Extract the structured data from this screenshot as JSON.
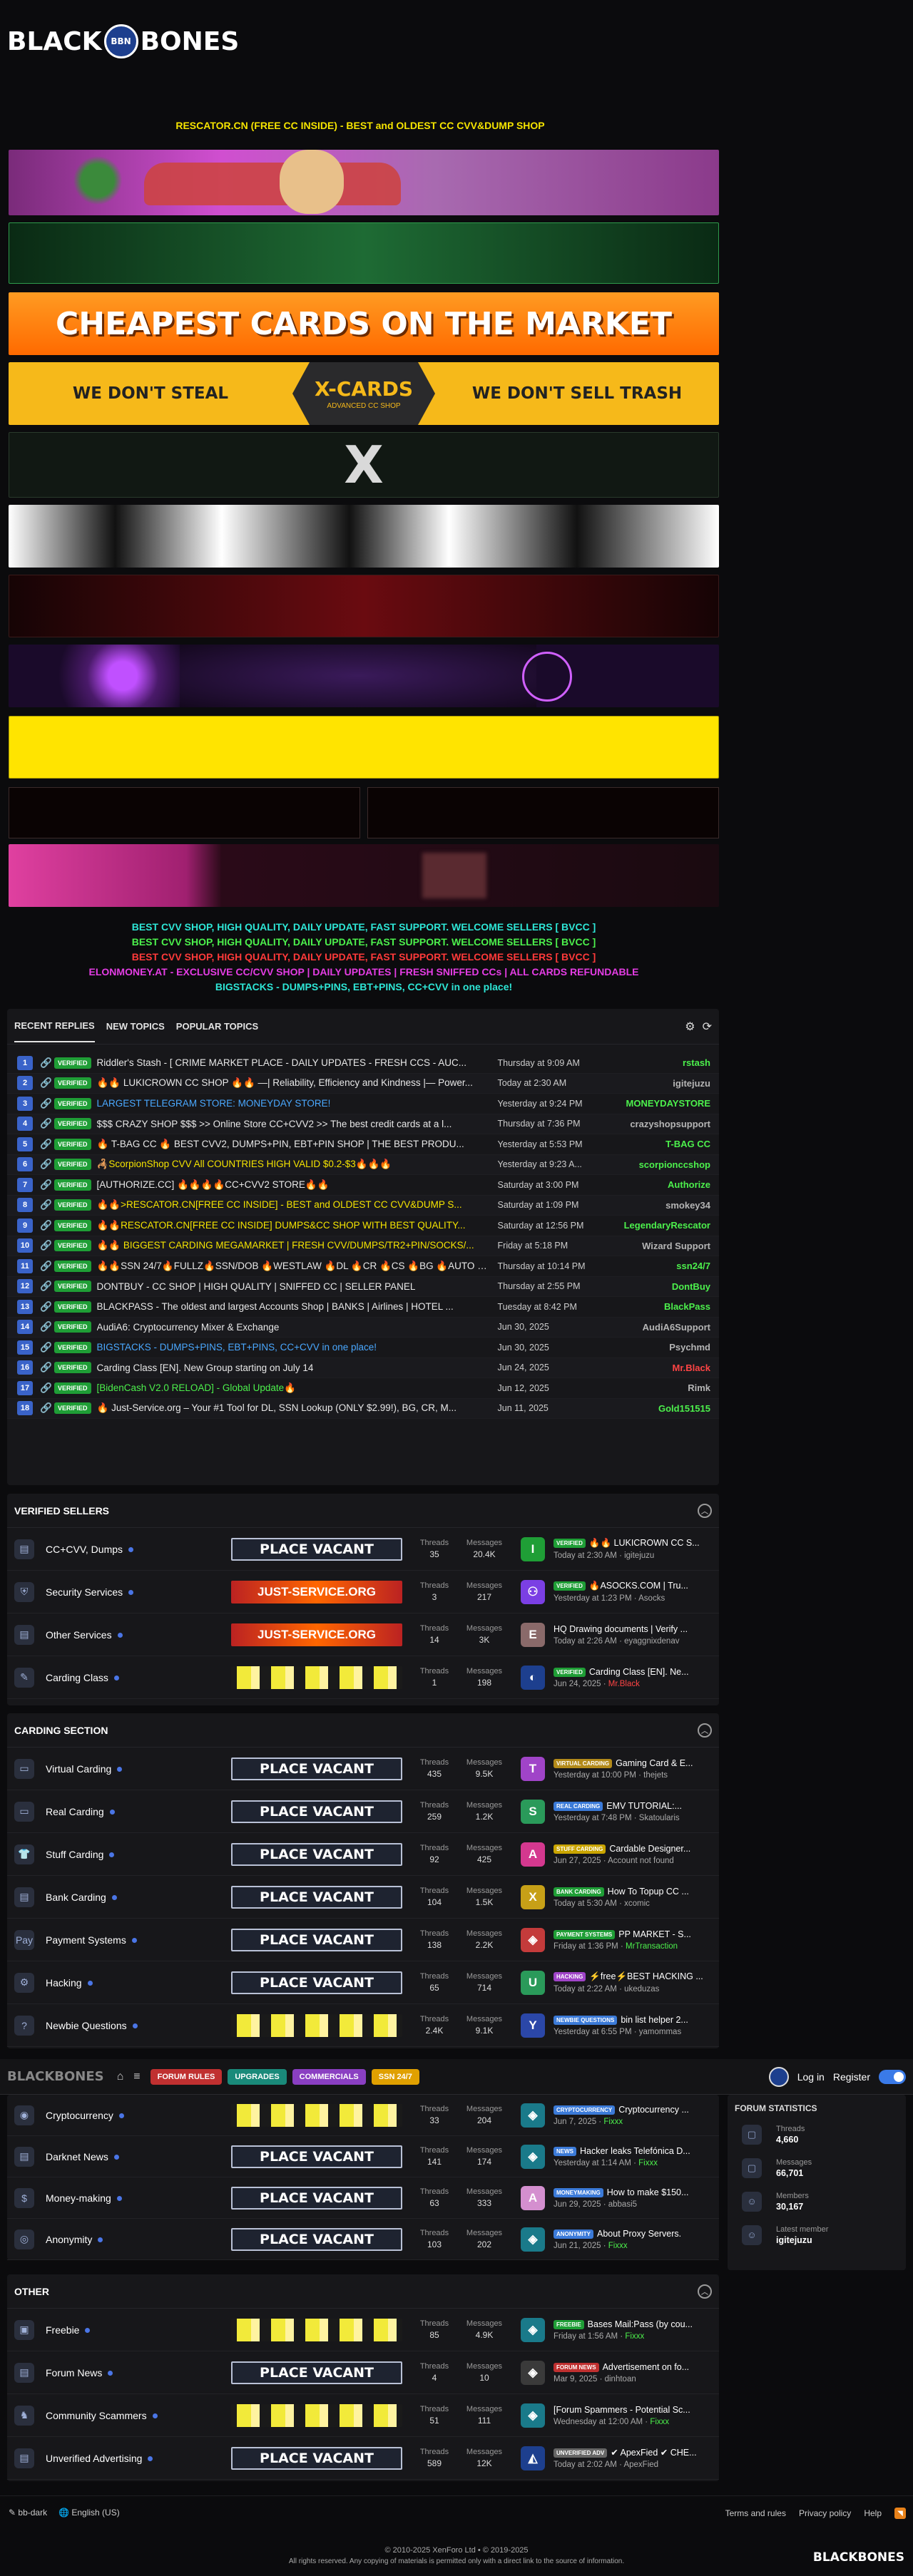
{
  "header": {
    "logo_left": "BLACK",
    "logo_right": "BONES",
    "logo_emblem": "BBN",
    "title": "RESCATOR.CN (FREE CC INSIDE) - BEST and OLDEST CC CVV&DUMP SHOP"
  },
  "banners": {
    "cheapest": "CHEAPEST CARDS ON THE MARKET",
    "xcards_left": "WE DON'T STEAL",
    "xcards_right": "WE DON'T SELL TRASH",
    "xcards_name": "X-CARDS",
    "xcards_sub": "ADVANCED CC SHOP",
    "x_letter": "X"
  },
  "ads": [
    {
      "text": "BEST CVV SHOP, HIGH QUALITY, DAILY UPDATE, FAST SUPPORT. WELCOME SELLERS [ BVCC ]",
      "color": "#2ee6d6"
    },
    {
      "text": "BEST CVV SHOP, HIGH QUALITY, DAILY UPDATE, FAST SUPPORT. WELCOME SELLERS [ BVCC ]",
      "color": "#4cf04c"
    },
    {
      "text": "BEST CVV SHOP, HIGH QUALITY, DAILY UPDATE, FAST SUPPORT. WELCOME SELLERS [ BVCC ]",
      "color": "#ff3a3a"
    },
    {
      "text": "ELONMONEY.AT - EXCLUSIVE CC/CVV SHOP | DAILY UPDATES | FRESH SNIFFED CCs | ALL CARDS REFUNDABLE",
      "color": "#e43de4"
    },
    {
      "text": "BIGSTACKS - DUMPS+PINS, EBT+PINS, CC+CVV in one place!",
      "color": "#2ee6d6"
    }
  ],
  "tabs": [
    "Recent replies",
    "New topics",
    "Popular topics"
  ],
  "badge_verified": "VERIFIED",
  "recent": [
    {
      "n": "1",
      "title": "Riddler's Stash - [ CRIME MARKET PLACE - DAILY UPDATES - FRESH CCS - AUC...",
      "date": "Thursday at 9:09 AM",
      "user": "rstash",
      "tcolor": "#e8e8e8",
      "ucolor": "#4cf04c"
    },
    {
      "n": "2",
      "title": "🔥🔥 LUKICROWN CC SHOP 🔥🔥 —| Reliability, Efficiency and Kindness |— Power...",
      "date": "Today at 2:30 AM",
      "user": "igitejuzu",
      "tcolor": "#e8e8e8",
      "ucolor": "#b5b5b5"
    },
    {
      "n": "3",
      "title": "LARGEST TELEGRAM STORE: MONEYDAY STORE!",
      "date": "Yesterday at 9:24 PM",
      "user": "MONEYDAYSTORE",
      "tcolor": "#4aa8ff",
      "ucolor": "#4cf04c"
    },
    {
      "n": "4",
      "title": "$$$ CRAZY SHOP $$$ >> Online Store CC+CVV2 >> The best credit cards at a l...",
      "date": "Thursday at 7:36 PM",
      "user": "crazyshopsupport",
      "tcolor": "#e8e8e8",
      "ucolor": "#b5b5b5"
    },
    {
      "n": "5",
      "title": "🔥 T-BAG CC 🔥 BEST CVV2, DUMPS+PIN, EBT+PIN SHOP | THE BEST PRODU...",
      "date": "Yesterday at 5:53 PM",
      "user": "T-BAG CC",
      "tcolor": "#e8e8e8",
      "ucolor": "#4cf04c"
    },
    {
      "n": "6",
      "title": "🦂ScorpionShop CVV All COUNTRIES HIGH VALID $0.2-$3🔥🔥🔥",
      "date": "Yesterday at 9:23 A...",
      "user": "scorpionccshop",
      "tcolor": "#f5e400",
      "ucolor": "#4cf04c"
    },
    {
      "n": "7",
      "title": "[AUTHORIZE.CC] 🔥🔥🔥🔥CC+CVV2 STORE🔥🔥",
      "date": "Saturday at 3:00 PM",
      "user": "Authorize",
      "tcolor": "#e8e8e8",
      "ucolor": "#4cf04c"
    },
    {
      "n": "8",
      "title": "🔥🔥>RESCATOR.CN[FREE CC INSIDE] - BEST and OLDEST CC CVV&DUMP S...",
      "date": "Saturday at 1:09 PM",
      "user": "smokey34",
      "tcolor": "#f5e400",
      "ucolor": "#b5b5b5"
    },
    {
      "n": "9",
      "title": "🔥🔥RESCATOR.CN[FREE CC INSIDE] DUMPS&CC SHOP WITH BEST QUALITY...",
      "date": "Saturday at 12:56 PM",
      "user": "LegendaryRescator",
      "tcolor": "#f5e400",
      "ucolor": "#4cf04c"
    },
    {
      "n": "10",
      "title": "🔥🔥 BIGGEST CARDING MEGAMARKET | FRESH CVV/DUMPS/TR2+PIN/SOCKS/...",
      "date": "Friday at 5:18 PM",
      "user": "Wizard Support",
      "tcolor": "#f5e400",
      "ucolor": "#b5b5b5"
    },
    {
      "n": "11",
      "title": "🔥🔥SSN 24/7🔥FULLZ🔥SSN/DOB 🔥WESTLAW 🔥DL 🔥CR 🔥CS 🔥BG 🔥AUTO -🔥BE...",
      "date": "Thursday at 10:14 PM",
      "user": "ssn24/7",
      "tcolor": "#e8e8e8",
      "ucolor": "#4cf04c"
    },
    {
      "n": "12",
      "title": "DONTBUY - CC SHOP | HIGH QUALITY | SNIFFED CC | SELLER PANEL",
      "date": "Thursday at 2:55 PM",
      "user": "DontBuy",
      "tcolor": "#e8e8e8",
      "ucolor": "#4cf04c"
    },
    {
      "n": "13",
      "title": "BLACKPASS - The oldest and largest Accounts Shop | BANKS | Airlines | HOTEL ...",
      "date": "Tuesday at 8:42 PM",
      "user": "BlackPass",
      "tcolor": "#e8e8e8",
      "ucolor": "#4cf04c"
    },
    {
      "n": "14",
      "title": "AudiA6: Cryptocurrency Mixer & Exchange",
      "date": "Jun 30, 2025",
      "user": "AudiA6Support",
      "tcolor": "#e8e8e8",
      "ucolor": "#b5b5b5"
    },
    {
      "n": "15",
      "title": "BIGSTACKS - DUMPS+PINS, EBT+PINS, CC+CVV in one place!",
      "date": "Jun 30, 2025",
      "user": "Psychmd",
      "tcolor": "#4aa8ff",
      "ucolor": "#b5b5b5"
    },
    {
      "n": "16",
      "title": "Carding Class [EN]. New Group starting on July 14",
      "date": "Jun 24, 2025",
      "user": "Mr.Black",
      "tcolor": "#e8e8e8",
      "ucolor": "#ff4444"
    },
    {
      "n": "17",
      "title": "[BidenCash V2.0 RELOAD] - Global Update🔥",
      "date": "Jun 12, 2025",
      "user": "Rimk",
      "tcolor": "#4cf04c",
      "ucolor": "#b5b5b5"
    },
    {
      "n": "18",
      "title": "🔥 Just-Service.org – Your #1 Tool for DL, SSN Lookup (ONLY $2.99!), BG, CR, M...",
      "date": "Jun 11, 2025",
      "user": "Gold151515",
      "tcolor": "#e8e8e8",
      "ucolor": "#4cf04c"
    }
  ],
  "labels": {
    "threads": "Threads",
    "messages": "Messages",
    "place_vacant": "PLACE VACANT",
    "just_service": "JUST-SERVICE.ORG"
  },
  "sections": [
    {
      "title": "Verified Sellers",
      "forums": [
        {
          "name": "CC+CVV, Dumps",
          "icon": "▤",
          "banner": "pv",
          "threads": "35",
          "messages": "20.4K",
          "av": "I",
          "avc": "#1f9e36",
          "pfx": "VERIFIED",
          "pfxc": "#1f9e36",
          "last": "🔥🔥 LUKICROWN CC S...",
          "when": "Today at 2:30 AM",
          "who": "igitejuzu",
          "whoc": "#aaa"
        },
        {
          "name": "Security Services",
          "icon": "⛨",
          "banner": "js",
          "threads": "3",
          "messages": "217",
          "av": "⚇",
          "avc": "#7b3fe4",
          "pfx": "VERIFIED",
          "pfxc": "#1f9e36",
          "last": "🔥ASOCKS.COM | Tru...",
          "when": "Yesterday at 1:23 PM",
          "who": "Asocks",
          "whoc": "#aaa"
        },
        {
          "name": "Other Services",
          "icon": "▤",
          "banner": "js",
          "threads": "14",
          "messages": "3K",
          "av": "E",
          "avc": "#8a6a6a",
          "pfx": "",
          "pfxc": "",
          "last": "HQ Drawing documents | Verify ...",
          "when": "Today at 2:26 AM",
          "who": "eyaggnixdenav",
          "whoc": "#aaa"
        },
        {
          "name": "Carding Class",
          "icon": "✎",
          "banner": "yb",
          "threads": "1",
          "messages": "198",
          "av": "◐",
          "avc": "#1d3f8e",
          "pfx": "VERIFIED",
          "pfxc": "#1f9e36",
          "last": "Carding Class [EN]. Ne...",
          "when": "Jun 24, 2025",
          "who": "Mr.Black",
          "whoc": "#ff4444"
        }
      ]
    },
    {
      "title": "Carding section",
      "forums": [
        {
          "name": "Virtual Carding",
          "icon": "▭",
          "banner": "pv",
          "threads": "435",
          "messages": "9.5K",
          "av": "T",
          "avc": "#a044c8",
          "pfx": "VIRTUAL CARDING",
          "pfxc": "#b38a1a",
          "last": "Gaming Card & E...",
          "when": "Yesterday at 10:00 PM",
          "who": "thejets",
          "whoc": "#aaa"
        },
        {
          "name": "Real Carding",
          "icon": "▭",
          "banner": "pv",
          "threads": "259",
          "messages": "1.2K",
          "av": "S",
          "avc": "#2a9a5a",
          "pfx": "REAL CARDING",
          "pfxc": "#3b7ad8",
          "last": "EMV TUTORIAL:...",
          "when": "Yesterday at 7:48 PM",
          "who": "Skatoularis",
          "whoc": "#aaa"
        },
        {
          "name": "Stuff Carding",
          "icon": "👕",
          "banner": "pv",
          "threads": "92",
          "messages": "425",
          "av": "A",
          "avc": "#d4388f",
          "pfx": "STUFF CARDING",
          "pfxc": "#c9a400",
          "last": "Cardable Designer...",
          "when": "Jun 27, 2025",
          "who": "Account not found",
          "whoc": "#aaa"
        },
        {
          "name": "Bank Carding",
          "icon": "▤",
          "banner": "pv",
          "threads": "104",
          "messages": "1.5K",
          "av": "X",
          "avc": "#c7a017",
          "pfx": "BANK CARDING",
          "pfxc": "#1f9e36",
          "last": "How To Topup CC ...",
          "when": "Today at 5:30 AM",
          "who": "xcomic",
          "whoc": "#aaa"
        },
        {
          "name": "Payment Systems",
          "icon": "Pay",
          "banner": "pv",
          "threads": "138",
          "messages": "2.2K",
          "av": "◈",
          "avc": "#c43b3b",
          "pfx": "PAYMENT SYSTEMS",
          "pfxc": "#1f9e36",
          "last": "PP MARKET - S...",
          "when": "Friday at 1:36 PM",
          "who": "MrTransaction",
          "whoc": "#4cf04c"
        },
        {
          "name": "Hacking",
          "icon": "⚙",
          "banner": "pv",
          "threads": "65",
          "messages": "714",
          "av": "U",
          "avc": "#2a9a5a",
          "pfx": "HACKING",
          "pfxc": "#a044c8",
          "last": "⚡free⚡BEST HACKING ...",
          "when": "Today at 2:22 AM",
          "who": "ukeduzas",
          "whoc": "#aaa"
        },
        {
          "name": "Newbie Questions",
          "icon": "?",
          "banner": "yb",
          "threads": "2.4K",
          "messages": "9.1K",
          "av": "Y",
          "avc": "#2b47a8",
          "pfx": "NEWBIE QUESTIONS",
          "pfxc": "#3b7ad8",
          "last": "bin list helper 2...",
          "when": "Yesterday at 6:55 PM",
          "who": "yamommas",
          "whoc": "#aaa"
        }
      ]
    }
  ],
  "sticky": {
    "mini_logo": "BLACKBONES",
    "nav": [
      {
        "label": "FORUM RULES",
        "color": "#c03030"
      },
      {
        "label": "UPGRADES",
        "color": "#1a8a7a"
      },
      {
        "label": "COMMERCIALS",
        "color": "#8a3fc2"
      },
      {
        "label": "SSN 24/7",
        "color": "#e0a000"
      }
    ],
    "login": "Log in",
    "register": "Register"
  },
  "more_forums": [
    {
      "name": "Cryptocurrency",
      "icon": "◉",
      "banner": "yb",
      "threads": "33",
      "messages": "204",
      "av": "◈",
      "avc": "#1a7a8a",
      "pfx": "CRYPTOCURRENCY",
      "pfxc": "#3b7ad8",
      "last": "Cryptocurrency ...",
      "when": "Jun 7, 2025",
      "who": "Fixxx",
      "whoc": "#4cf04c"
    },
    {
      "name": "Darknet News",
      "icon": "▤",
      "banner": "pv",
      "threads": "141",
      "messages": "174",
      "av": "◈",
      "avc": "#1a7a8a",
      "pfx": "NEWS",
      "pfxc": "#3b7ad8",
      "last": "Hacker leaks Telefónica D...",
      "when": "Yesterday at 1:14 AM",
      "who": "Fixxx",
      "whoc": "#4cf04c"
    },
    {
      "name": "Money-making",
      "icon": "$",
      "banner": "pv",
      "threads": "63",
      "messages": "333",
      "av": "A",
      "avc": "#d48fcf",
      "pfx": "MONEYMAKING",
      "pfxc": "#3b7ad8",
      "last": "How to make $150...",
      "when": "Jun 29, 2025",
      "who": "abbasi5",
      "whoc": "#aaa"
    },
    {
      "name": "Anonymity",
      "icon": "◎",
      "banner": "pv",
      "threads": "103",
      "messages": "202",
      "av": "◈",
      "avc": "#1a7a8a",
      "pfx": "ANONYMITY",
      "pfxc": "#3b7ad8",
      "last": "About Proxy Servers.",
      "when": "Jun 21, 2025",
      "who": "Fixxx",
      "whoc": "#4cf04c"
    }
  ],
  "other": {
    "title": "Other",
    "forums": [
      {
        "name": "Freebie",
        "icon": "▣",
        "banner": "yb",
        "threads": "85",
        "messages": "4.9K",
        "av": "◈",
        "avc": "#1a7a8a",
        "pfx": "FREEBIE",
        "pfxc": "#1f9e36",
        "last": "Bases Mail:Pass (by cou...",
        "when": "Friday at 1:56 AM",
        "who": "Fixxx",
        "whoc": "#4cf04c"
      },
      {
        "name": "Forum News",
        "icon": "▤",
        "banner": "pv",
        "threads": "4",
        "messages": "10",
        "av": "◈",
        "avc": "#3a3a3a",
        "pfx": "FORUM NEWS",
        "pfxc": "#c03030",
        "last": "Advertisement on fo...",
        "when": "Mar 9, 2025",
        "who": "dinhtoan",
        "whoc": "#aaa"
      },
      {
        "name": "Community Scammers",
        "icon": "♞",
        "banner": "yb",
        "threads": "51",
        "messages": "111",
        "av": "◈",
        "avc": "#1a7a8a",
        "pfx": "",
        "pfxc": "",
        "last": "[Forum Spammers - Potential Sc...",
        "when": "Wednesday at 12:00 AM",
        "who": "Fixxx",
        "whoc": "#4cf04c"
      },
      {
        "name": "Unverified Advertising",
        "icon": "▤",
        "banner": "pv",
        "threads": "589",
        "messages": "12K",
        "av": "◭",
        "avc": "#1d3f8e",
        "pfx": "UNVERIFIED ADV",
        "pfxc": "#666",
        "last": "✔ ApexFied ✔ CHE...",
        "when": "Today at 2:02 AM",
        "who": "ApexFied",
        "whoc": "#aaa"
      }
    ]
  },
  "stats": {
    "title": "FORUM STATISTICS",
    "items": [
      {
        "k": "Threads",
        "v": "4,660",
        "i": "▢"
      },
      {
        "k": "Messages",
        "v": "66,701",
        "i": "▢"
      },
      {
        "k": "Members",
        "v": "30,167",
        "i": "☺"
      },
      {
        "k": "Latest member",
        "v": "igitejuzu",
        "i": "☺"
      }
    ]
  },
  "footer": {
    "style": "bb-dark",
    "lang": "English (US)",
    "links": [
      "Terms and rules",
      "Privacy policy",
      "Help"
    ],
    "copy1": "© 2010-2025 XenForo Ltd • © 2019-2025",
    "copy2": "All rights reserved. Any copying of materials is permitted only with a direct link to the source of information.",
    "logo": "BLACKBONES"
  }
}
